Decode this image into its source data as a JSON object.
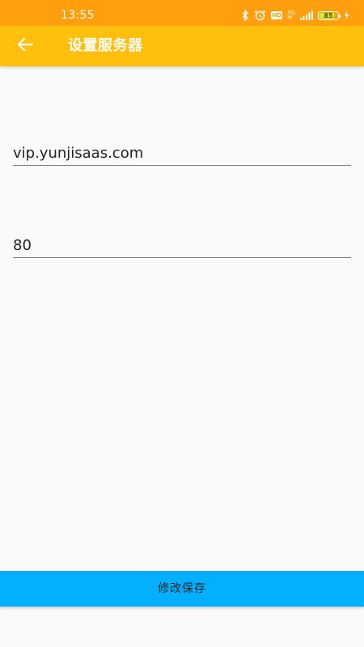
{
  "status_bar": {
    "time": "13:55",
    "icons": [
      "bluetooth-icon",
      "alarm-icon",
      "hd-icon",
      "5g-icon",
      "signal-icon",
      "battery-icon",
      "charging-icon"
    ],
    "hd_label": "HD",
    "network_label": "5G",
    "network_sub": "46",
    "battery_level": "85",
    "battery_fill_color": "#c6f33a",
    "background_color": "#ff9f0d"
  },
  "app_bar": {
    "title": "设置服务器",
    "back_icon": "arrow-left-icon",
    "background_color": "#ffbf0d"
  },
  "form": {
    "host_value": "vip.yunjisaas.com",
    "port_value": "80"
  },
  "save_button": {
    "label": "修改保存",
    "background_color": "#03b0ff"
  }
}
